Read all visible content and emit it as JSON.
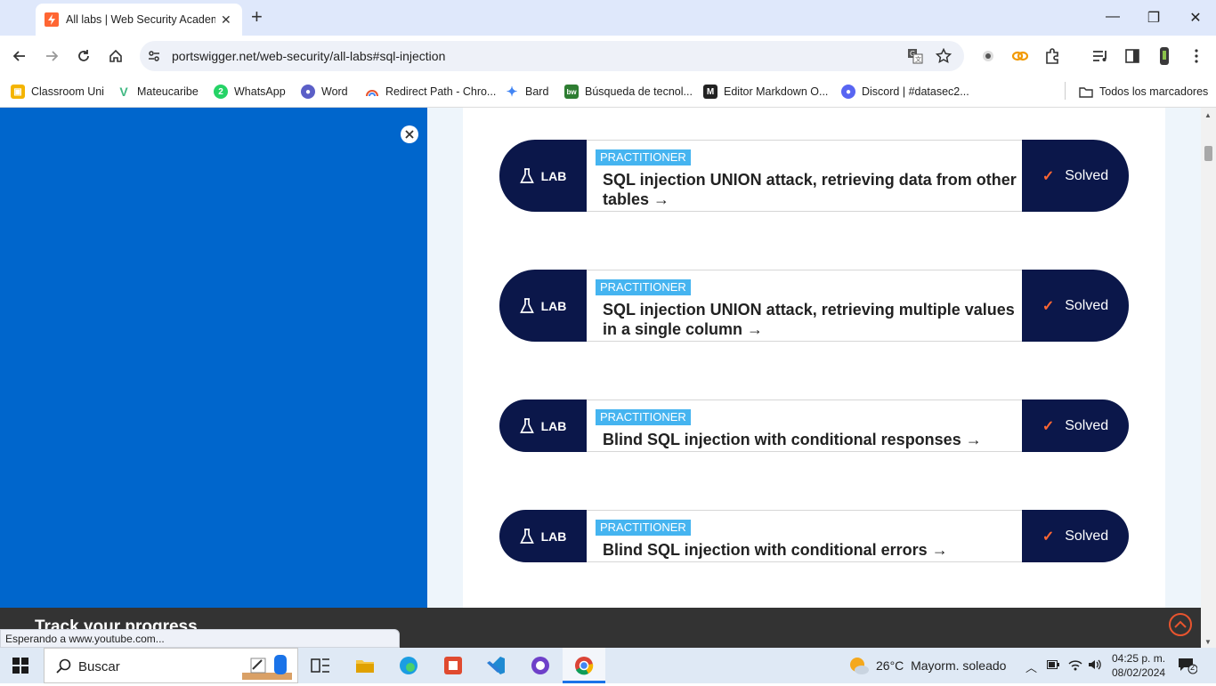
{
  "browser": {
    "tab": {
      "title": "All labs | Web Security Academy"
    },
    "url": "portswigger.net/web-security/all-labs#sql-injection",
    "bookmarks": [
      {
        "label": "Classroom Uni",
        "icon": "classroom-icon",
        "color": "#f4b400"
      },
      {
        "label": "Mateucaribe",
        "icon": "vue-icon",
        "color": "#41b883"
      },
      {
        "label": "WhatsApp",
        "icon": "whatsapp-icon",
        "color": "#25d366"
      },
      {
        "label": "Word",
        "icon": "word-icon",
        "color": "#5b5fc7"
      },
      {
        "label": "Redirect Path - Chro...",
        "icon": "rainbow-icon",
        "color": "#e8542e"
      },
      {
        "label": "Bard",
        "icon": "bard-icon",
        "color": "#4285f4"
      },
      {
        "label": "Búsqueda de tecnol...",
        "icon": "builtwith-icon",
        "color": "#2e7d32"
      },
      {
        "label": "Editor Markdown O...",
        "icon": "markdown-icon",
        "color": "#222222"
      },
      {
        "label": "Discord | #datasec2...",
        "icon": "discord-icon",
        "color": "#5865f2"
      }
    ],
    "all_bookmarks": "Todos los marcadores"
  },
  "labs": [
    {
      "badge": "LAB",
      "level": "PRACTITIONER",
      "title": "SQL injection UNION attack, retrieving data from other tables →",
      "status": "Solved"
    },
    {
      "badge": "LAB",
      "level": "PRACTITIONER",
      "title": "SQL injection UNION attack, retrieving multiple values in a single column →",
      "status": "Solved"
    },
    {
      "badge": "LAB",
      "level": "PRACTITIONER",
      "title": "Blind SQL injection with conditional responses →",
      "status": "Solved"
    },
    {
      "badge": "LAB",
      "level": "PRACTITIONER",
      "title": "Blind SQL injection with conditional errors →",
      "status": "Solved"
    }
  ],
  "footer": {
    "track_text": "Track your progress"
  },
  "status_text": "Esperando a www.youtube.com...",
  "taskbar": {
    "search_label": "Buscar",
    "weather_temp": "26°C",
    "weather_desc": "Mayorm. soleado",
    "time": "04:25 p. m.",
    "date": "08/02/2024",
    "notification_count": "2"
  },
  "colors": {
    "panel_blue": "#0066cc",
    "lab_navy": "#0b174a",
    "level_pill": "#45b4f0",
    "check_orange": "#ff6633"
  }
}
